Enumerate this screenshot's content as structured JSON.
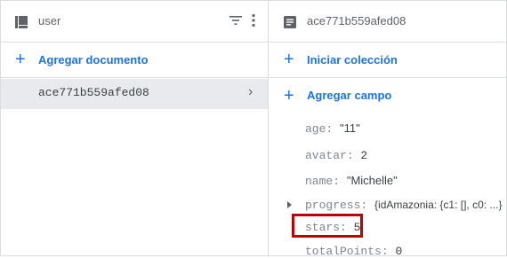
{
  "left_panel": {
    "collection_name": "user",
    "add_document_label": "Agregar documento",
    "documents": [
      {
        "id": "ace771b559afed08"
      }
    ]
  },
  "right_panel": {
    "document_id": "ace771b559afed08",
    "start_collection_label": "Iniciar colección",
    "add_field_label": "Agregar campo",
    "fields": [
      {
        "key": "age",
        "value": "\"11\""
      },
      {
        "key": "avatar",
        "value": "2"
      },
      {
        "key": "name",
        "value": "\"Michelle\""
      },
      {
        "key": "progress",
        "value": "{idAmazonia: {c1: [], c0: ...}"
      },
      {
        "key": "stars",
        "value": "5"
      },
      {
        "key": "totalPoints",
        "value": "0"
      }
    ]
  },
  "icons": {
    "collection": "collection-icon",
    "filter": "filter-icon",
    "more": "more-vert-icon",
    "document": "document-icon",
    "add": "plus-icon",
    "chevron": "chevron-right-icon",
    "expand": "expand-caret-icon"
  },
  "colors": {
    "accent": "#1a73e8",
    "selected_row": "#e8eaed",
    "highlight_box": "#c00000"
  }
}
